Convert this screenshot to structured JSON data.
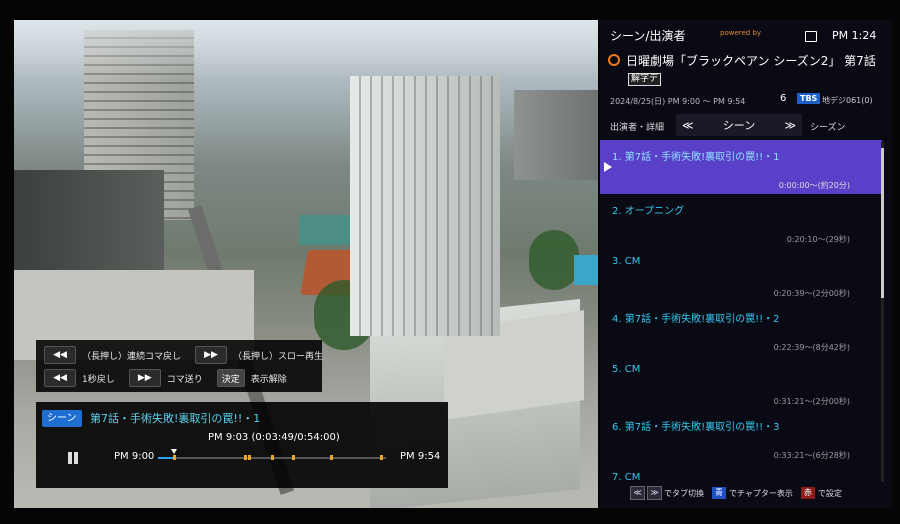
{
  "scene_help": {
    "rows": [
      [
        {
          "key": "◀◀",
          "label": "（長押し）連続コマ戻し"
        },
        {
          "key": "▶▶",
          "label": "（長押し）スロー再生"
        }
      ],
      [
        {
          "key": "◀◀",
          "label": "1秒戻し"
        },
        {
          "key": "▶▶",
          "label": "コマ送り"
        },
        {
          "key": "決定",
          "label": "表示解除"
        }
      ]
    ]
  },
  "playback": {
    "tag": "シーン",
    "title": "第7話・手術失敗!裏取引の罠!!・1",
    "current_time": "PM 9:03 (0:03:49/0:54:00)",
    "start": "PM 9:00",
    "end": "PM 9:54",
    "progress": 0.07,
    "chapter_marks": [
      0.07,
      0.38,
      0.4,
      0.5,
      0.59,
      0.76,
      0.98
    ]
  },
  "panel": {
    "header": "シーン/出演者",
    "logo": "powered by",
    "clock": "PM 1:24",
    "program_title": "日曜劇場「ブラックペアン シーズン2」 第7話",
    "program_badge": "解字デ",
    "air_date": "2024/8/25(日) PM 9:00 〜 PM 9:54",
    "channel_number": "6",
    "channel_logo": "TBS",
    "channel_name": "地デジ061(0)",
    "tab_left": "出演者・詳細",
    "tab_prev": "≪",
    "tab_current": "シーン",
    "tab_next": "≫",
    "tab_right": "シーズン",
    "scenes": [
      {
        "title": "1. 第7話・手術失敗!裏取引の罠!!・1",
        "time": "0:00:00〜(約20分)"
      },
      {
        "title": "2. オープニング",
        "time": "0:20:10〜(29秒)"
      },
      {
        "title": "3. CM",
        "time": "0:20:39〜(2分00秒)"
      },
      {
        "title": "4. 第7話・手術失敗!裏取引の罠!!・2",
        "time": "0:22:39〜(8分42秒)"
      },
      {
        "title": "5. CM",
        "time": "0:31:21〜(2分00秒)"
      },
      {
        "title": "6. 第7話・手術失敗!裏取引の罠!!・3",
        "time": "0:33:21〜(6分28秒)"
      },
      {
        "title": "7. CM",
        "time": ""
      }
    ],
    "footer": {
      "k1": "≪",
      "k2": "≫",
      "t1": "でタブ切換",
      "blue": "青",
      "t2": "でチャプター表示",
      "red": "赤",
      "t3": "で設定"
    }
  },
  "colors": {
    "selected_row": "#5a3fc8",
    "accent_text": "#35c6ec",
    "scene_tag": "#1f6fd3"
  }
}
